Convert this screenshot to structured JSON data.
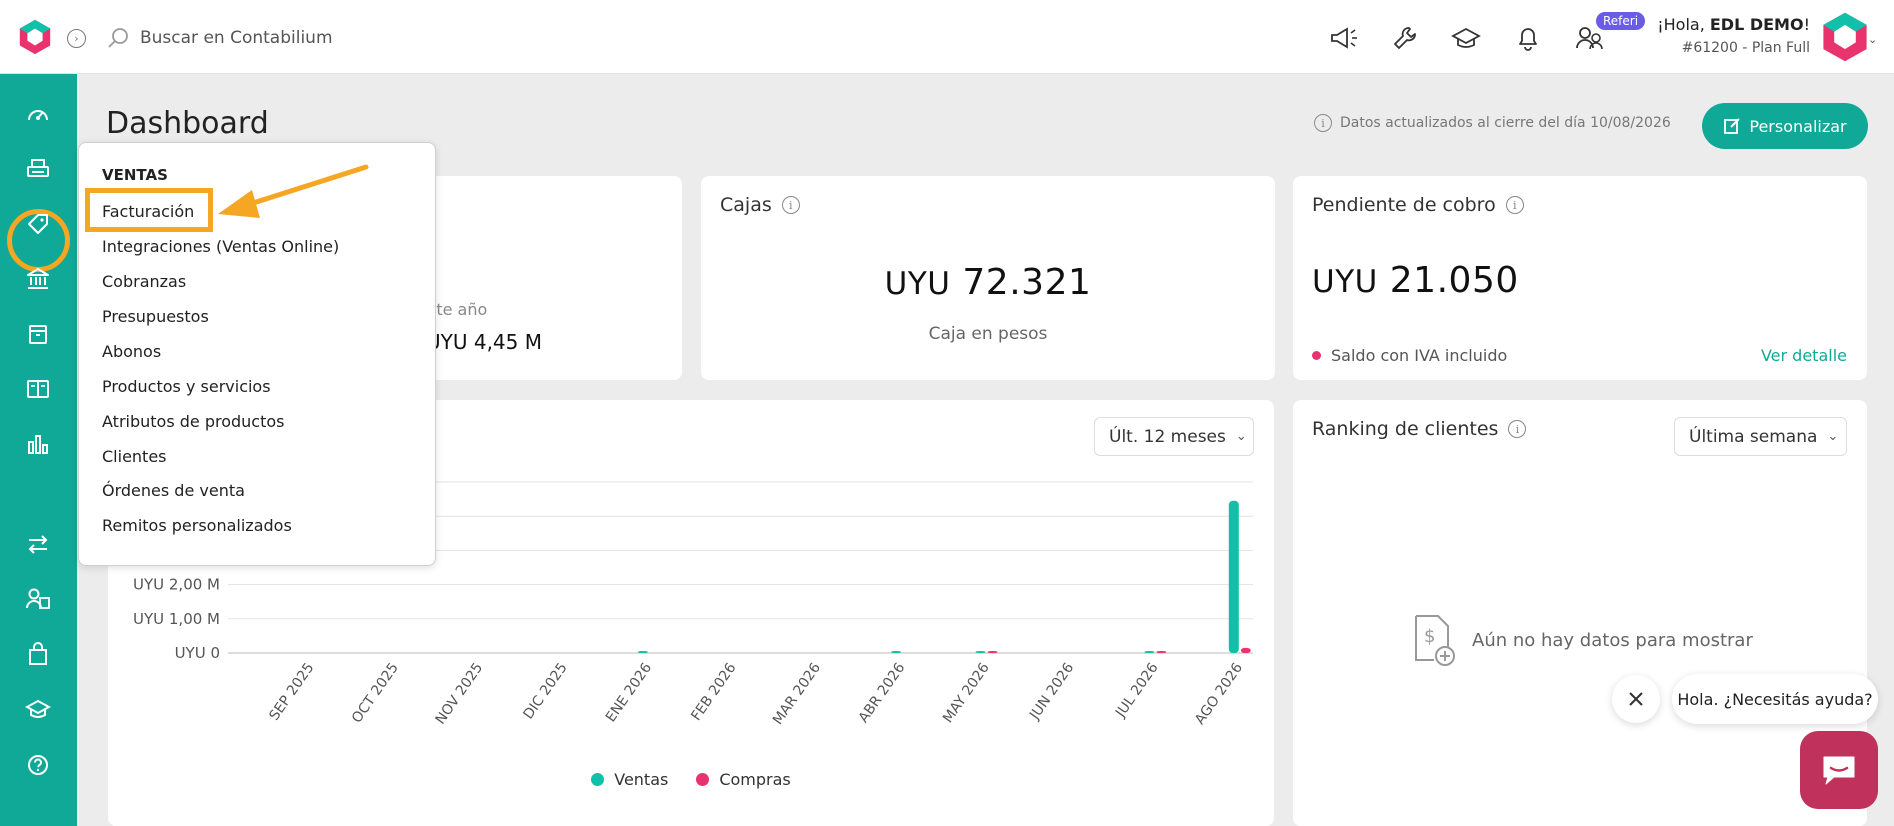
{
  "header": {
    "search_placeholder": "Buscar en Contabilium",
    "refer_badge": "Referi",
    "greeting_prefix": "¡Hola, ",
    "user_name": "EDL DEMO",
    "greeting_suffix": "!",
    "plan": "#61200 - Plan Full"
  },
  "page": {
    "title": "Dashboard",
    "updated_text": "Datos actualizados al cierre del día 10/08/2026",
    "customize_button": "Personalizar"
  },
  "ventas_card": {
    "subtitle_fragment": "ste año",
    "amount_fragment": "UYU 4,45 M"
  },
  "cajas_card": {
    "title": "Cajas",
    "currency": "UYU",
    "amount": "72.321",
    "caption": "Caja en pesos"
  },
  "pendiente_card": {
    "title": "Pendiente de cobro",
    "currency": "UYU",
    "amount": "21.050",
    "note": "Saldo con IVA incluido",
    "link": "Ver detalle",
    "dot_color": "#e8336e"
  },
  "chart_card": {
    "period_select": "Últ. 12 meses",
    "legend": [
      "Ventas",
      "Compras"
    ]
  },
  "chart_data": {
    "type": "bar",
    "categories": [
      "SEP 2025",
      "OCT 2025",
      "NOV 2025",
      "DIC 2025",
      "ENE 2026",
      "FEB 2026",
      "MAR 2026",
      "ABR 2026",
      "MAY 2026",
      "JUN 2026",
      "JUL 2026",
      "AGO 2026"
    ],
    "series": [
      {
        "name": "Ventas",
        "color": "#10c0a8",
        "values": [
          0,
          0,
          0,
          0,
          0.01,
          0,
          0,
          0.02,
          0.01,
          0,
          0.02,
          4.45
        ]
      },
      {
        "name": "Compras",
        "color": "#e8336e",
        "values": [
          0,
          0,
          0,
          0,
          0,
          0,
          0,
          0,
          0.02,
          0,
          0.02,
          0.15
        ]
      }
    ],
    "ytick_labels": [
      "UYU 0",
      "UYU 1,00 M",
      "UYU 2,00 M"
    ],
    "ylim": [
      0,
      5
    ],
    "grid": true,
    "legend_position": "bottom"
  },
  "ranking_card": {
    "title": "Ranking de clientes",
    "period_select": "Última semana",
    "empty_text": "Aún no hay datos para mostrar"
  },
  "menu": {
    "heading": "VENTAS",
    "items": [
      "Facturación",
      "Integraciones (Ventas Online)",
      "Cobranzas",
      "Presupuestos",
      "Abonos",
      "Productos y servicios",
      "Atributos de productos",
      "Clientes",
      "Órdenes de venta",
      "Remitos personalizados"
    ]
  },
  "chat": {
    "bubble_text": "Hola. ¿Necesitás ayuda?"
  },
  "colors": {
    "brand": "#10a998",
    "highlight": "#f5a623",
    "chat": "#c0315c"
  },
  "icons": {
    "sidebar": [
      "dashboard-icon",
      "ventas-icon",
      "tag-icon",
      "bank-icon",
      "archive-icon",
      "book-icon",
      "reports-icon",
      "transfer-icon",
      "contacts-icon",
      "bag-icon",
      "academy-icon",
      "help-icon"
    ]
  }
}
